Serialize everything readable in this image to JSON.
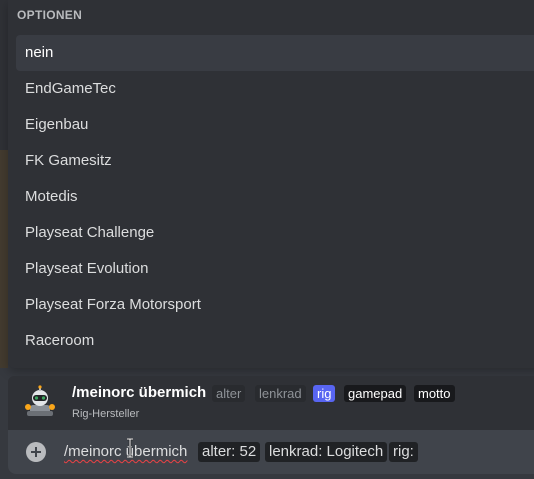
{
  "options": {
    "header": "OPTIONEN",
    "items": [
      {
        "label": "nein",
        "selected": true
      },
      {
        "label": "EndGameTec"
      },
      {
        "label": "Eigenbau"
      },
      {
        "label": "FK Gamesitz"
      },
      {
        "label": "Motedis"
      },
      {
        "label": "Playseat Challenge"
      },
      {
        "label": "Playseat Evolution"
      },
      {
        "label": "Playseat Forza Motorsport"
      },
      {
        "label": "Raceroom"
      }
    ]
  },
  "command_preview": {
    "name": "/meinorc übermich",
    "description": "Rig-Hersteller",
    "params": [
      "alter",
      "lenkrad",
      "rig",
      "gamepad",
      "motto"
    ],
    "active_param": "rig"
  },
  "input": {
    "command": "/meinorc übermich",
    "filled": [
      "alter: 52",
      "lenkrad: Logitech",
      "rig:"
    ]
  },
  "icons": {
    "avatar": "robot-avatar-icon",
    "add": "plus-circle-icon",
    "cursor": "text-cursor-icon"
  },
  "colors": {
    "accent": "#5865f2",
    "error_underline": "#ed4245"
  }
}
